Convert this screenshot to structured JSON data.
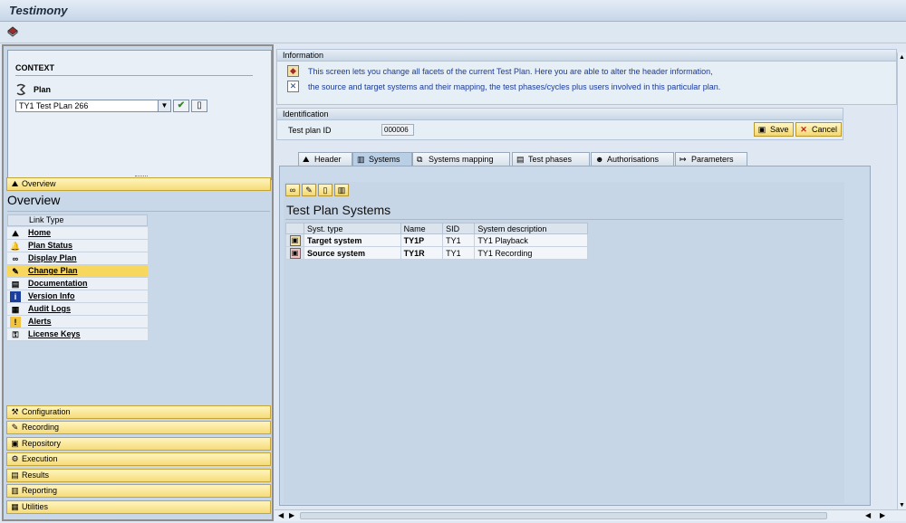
{
  "window": {
    "title": "Testimony"
  },
  "toolbar": {
    "icon": "book-icon"
  },
  "context": {
    "title": "CONTEXT",
    "plan_label": "Plan",
    "plan_value": "TY1 Test PLan 266",
    "confirm_icon": "checkmark-icon",
    "new_icon": "new-document-icon"
  },
  "nav": {
    "overview": "Overview",
    "sections": [
      "Configuration",
      "Recording",
      "Repository",
      "Execution",
      "Results",
      "Reporting",
      "Utilities"
    ]
  },
  "overview": {
    "heading": "Overview",
    "column": "Link Type",
    "links": [
      "Home",
      "Plan Status",
      "Display Plan",
      "Change Plan",
      "Documentation",
      "Version Info",
      "Audit Logs",
      "Alerts",
      "License Keys"
    ],
    "selected": "Change Plan"
  },
  "info": {
    "title": "Information",
    "line1": "This screen lets you change all facets of the current Test Plan. Here you are able to alter the header information,",
    "line2": "the source and target systems and their mapping, the test phases/cycles plus users involved in this particular plan."
  },
  "identification": {
    "title": "Identification",
    "label": "Test plan ID",
    "value": "000006",
    "save": "Save",
    "cancel": "Cancel"
  },
  "tabs": [
    "Header",
    "Systems",
    "Systems mapping",
    "Test phases",
    "Authorisations",
    "Parameters"
  ],
  "active_tab": "Systems",
  "systems": {
    "title": "Test Plan Systems",
    "columns": [
      "Syst. type",
      "Name",
      "SID",
      "System description"
    ],
    "rows": [
      {
        "type": "Target system",
        "name": "TY1P",
        "sid": "TY1",
        "desc": "TY1 Playback"
      },
      {
        "type": "Source system",
        "name": "TY1R",
        "sid": "TY1",
        "desc": "TY1 Recording"
      }
    ]
  },
  "colors": {
    "selected": "#f8d75e",
    "info_text": "#1a3a9a"
  }
}
